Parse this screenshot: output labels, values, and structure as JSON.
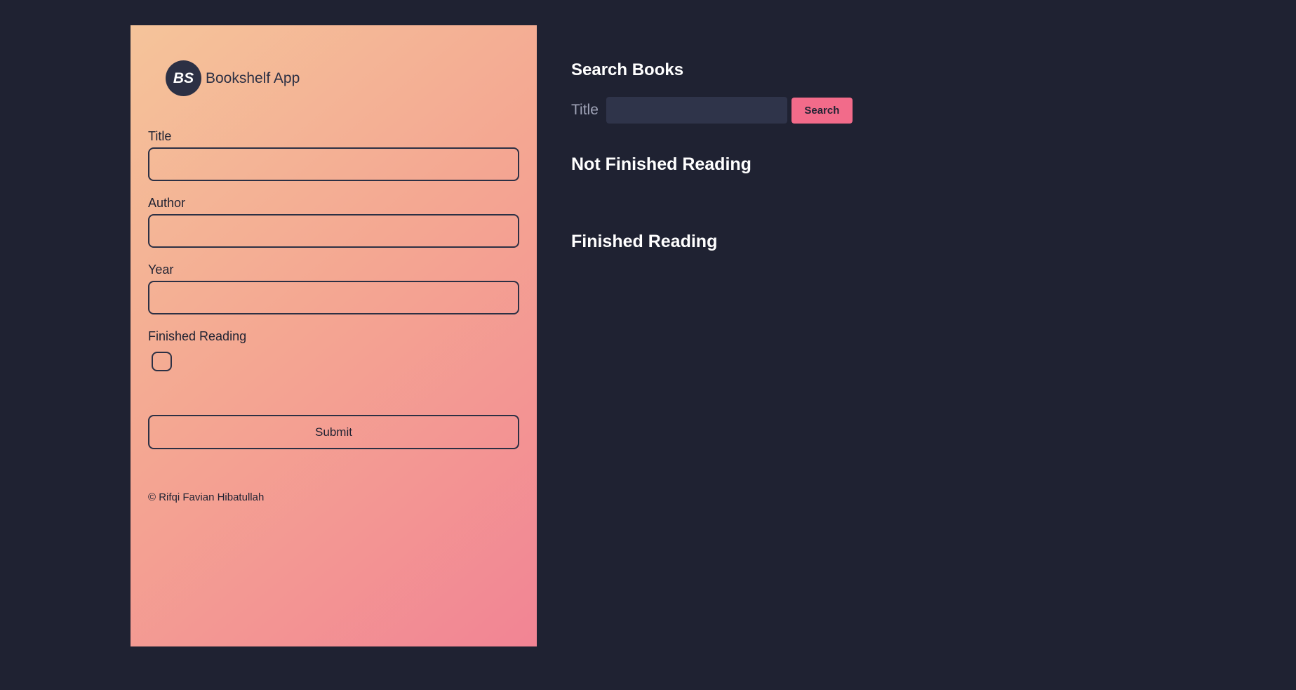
{
  "brand": {
    "logo_text": "BS",
    "name": "Bookshelf App"
  },
  "form": {
    "title_label": "Title",
    "title_value": "",
    "author_label": "Author",
    "author_value": "",
    "year_label": "Year",
    "year_value": "",
    "finished_label": "Finished Reading",
    "finished_checked": false,
    "submit_label": "Submit"
  },
  "footer": {
    "copyright": "© Rifqi Favian Hibatullah"
  },
  "search": {
    "heading": "Search Books",
    "label": "Title",
    "value": "",
    "button_label": "Search"
  },
  "shelves": {
    "unfinished_heading": "Not Finished Reading",
    "finished_heading": "Finished Reading"
  },
  "colors": {
    "background": "#1f2232",
    "panel_gradient_start": "#f5c49a",
    "panel_gradient_end": "#f28494",
    "accent": "#f26b8a",
    "dark": "#2c3044"
  }
}
